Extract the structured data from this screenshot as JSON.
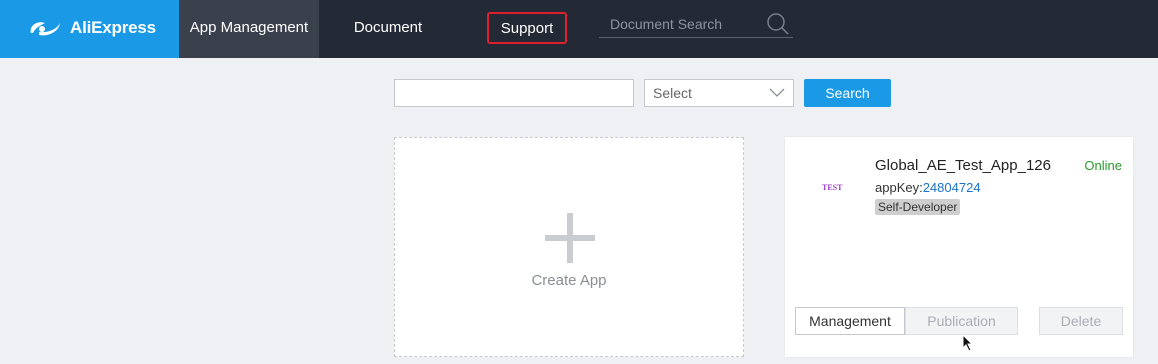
{
  "brand": {
    "name": "AliExpress",
    "color": "#1a9ae6"
  },
  "nav": {
    "app_management": "App Management",
    "document": "Document",
    "support": "Support",
    "doc_search_placeholder": "Document Search"
  },
  "filters": {
    "text_value": "",
    "select_label": "Select",
    "search_button": "Search"
  },
  "create_card": {
    "label": "Create App"
  },
  "app": {
    "thumb_text": "TEST",
    "name": "Global_AE_Test_App_126",
    "status": "Online",
    "key_label": "appKey:",
    "key_value": "24804724",
    "tag": "Self-Developer",
    "buttons": {
      "management": "Management",
      "publication": "Publication",
      "delete": "Delete"
    }
  }
}
